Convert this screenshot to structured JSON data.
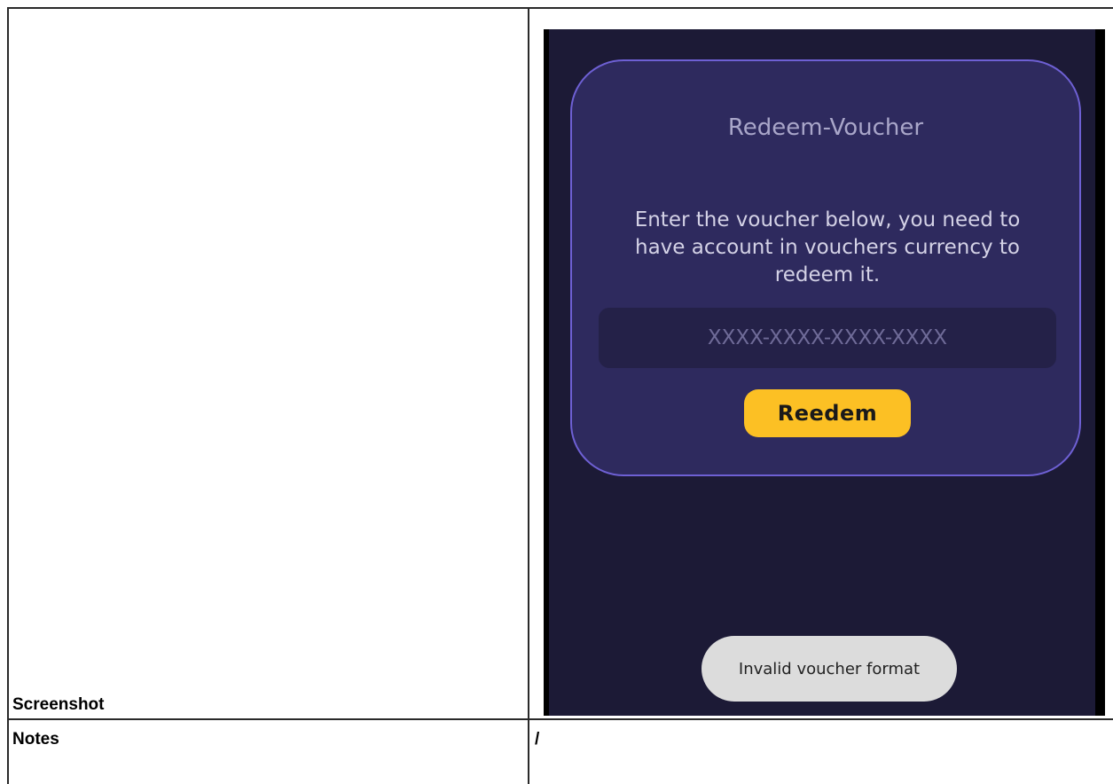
{
  "table": {
    "screenshot_label": "Screenshot",
    "notes_label": "Notes",
    "notes_value": "/"
  },
  "app": {
    "card": {
      "title": "Redeem-Voucher",
      "description": "Enter the voucher below, you need to have account in vouchers currency to redeem it.",
      "voucher_input": {
        "value": "",
        "placeholder": "XXXX-XXXX-XXXX-XXXX"
      },
      "redeem_label": "Reedem"
    },
    "toast": {
      "message": "Invalid voucher format"
    },
    "colors": {
      "screen_background": "#1c1a36",
      "card_background": "#2e2a5e",
      "card_border": "#6e60d4",
      "button": "#fcc024",
      "toast": "#dcdcdc"
    }
  }
}
